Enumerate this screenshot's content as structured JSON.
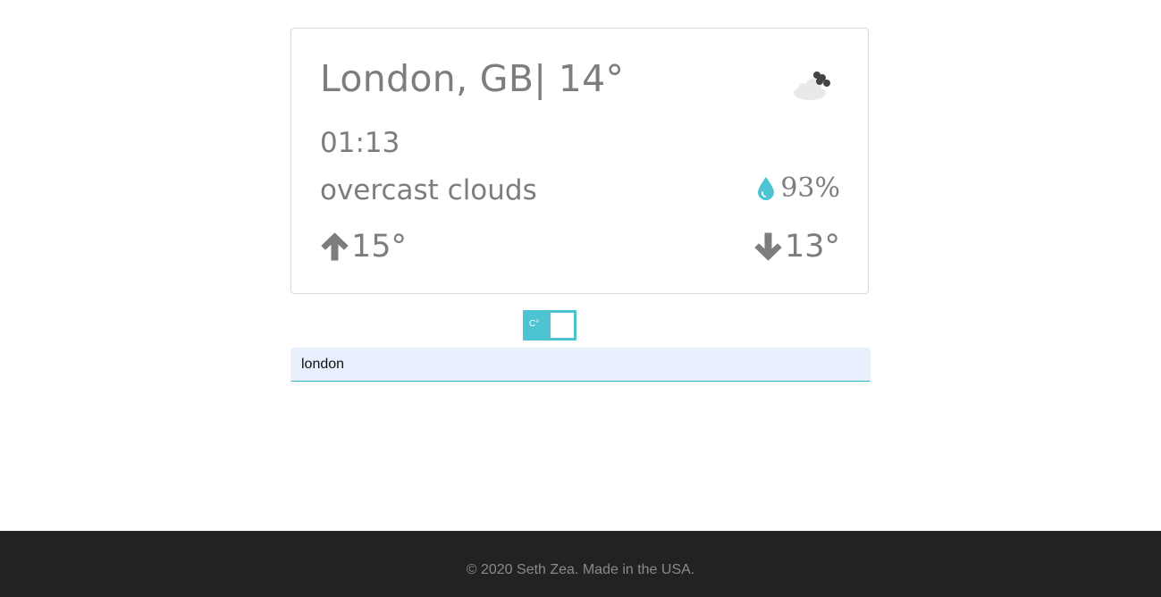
{
  "weather": {
    "headline": "London, GB| 14°",
    "time": "01:13",
    "description": "overcast clouds",
    "humidity": "93%",
    "temp_high": "15°",
    "temp_low": "13°",
    "icon": "cloud-icon"
  },
  "unit_toggle": {
    "label": "C°"
  },
  "search": {
    "value": "london"
  },
  "footer": {
    "text": "© 2020 Seth Zea. Made in the USA."
  },
  "colors": {
    "accent": "#4ec3d2",
    "text": "#7d7d7d",
    "footer_bg": "#222222"
  }
}
